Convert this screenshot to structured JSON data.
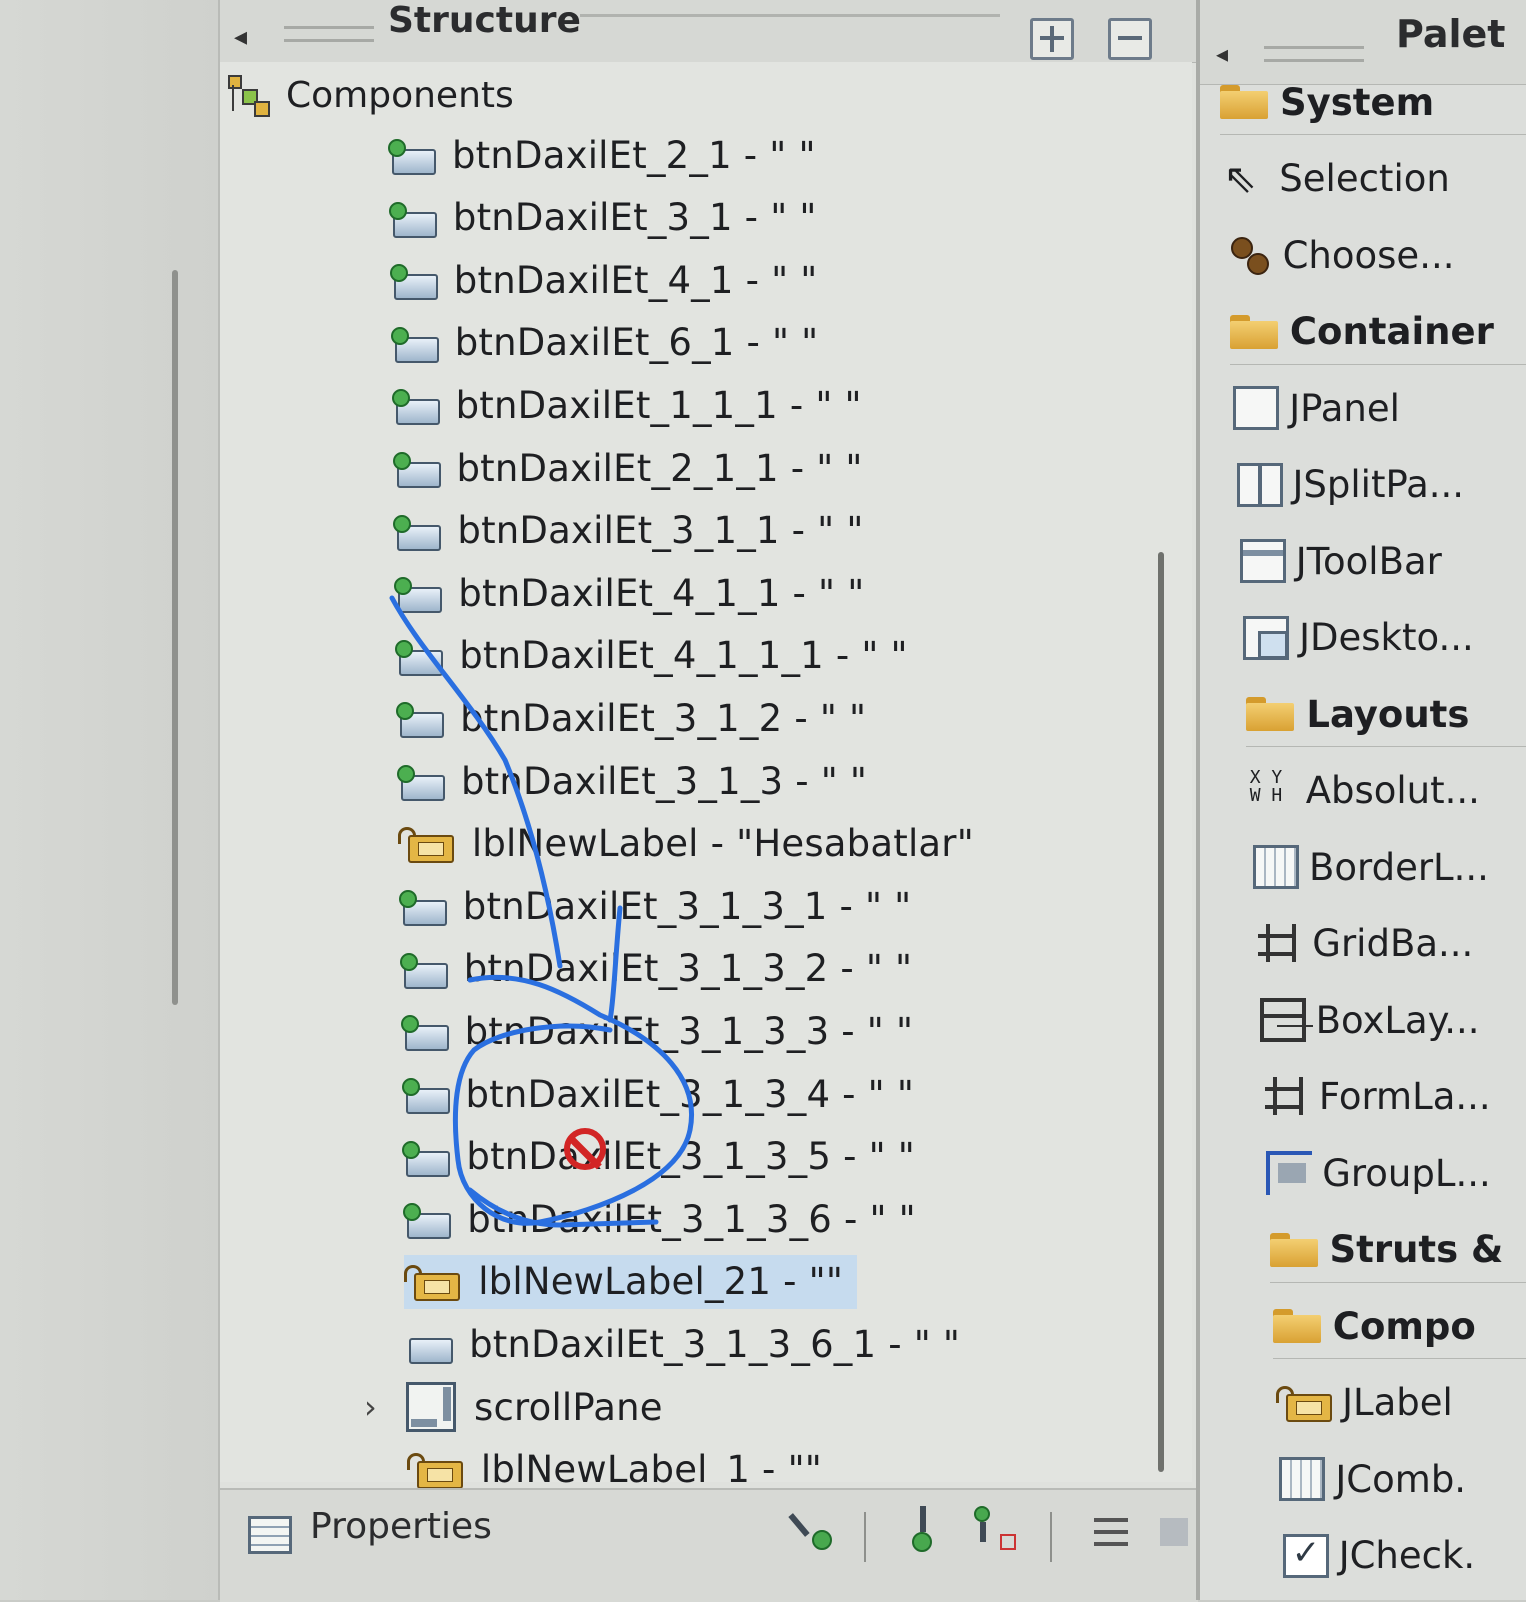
{
  "structure": {
    "title": "Structure",
    "root_label": "Components",
    "items": [
      {
        "label": "btnDaxilEt_2_1 - \" \"",
        "type": "button"
      },
      {
        "label": "btnDaxilEt_3_1 - \" \"",
        "type": "button"
      },
      {
        "label": "btnDaxilEt_4_1 - \" \"",
        "type": "button"
      },
      {
        "label": "btnDaxilEt_6_1 - \" \"",
        "type": "button"
      },
      {
        "label": "btnDaxilEt_1_1_1 - \" \"",
        "type": "button"
      },
      {
        "label": "btnDaxilEt_2_1_1 - \" \"",
        "type": "button"
      },
      {
        "label": "btnDaxilEt_3_1_1 - \" \"",
        "type": "button"
      },
      {
        "label": "btnDaxilEt_4_1_1 - \" \"",
        "type": "button"
      },
      {
        "label": "btnDaxilEt_4_1_1_1 - \" \"",
        "type": "button"
      },
      {
        "label": "btnDaxilEt_3_1_2 - \" \"",
        "type": "button"
      },
      {
        "label": "btnDaxilEt_3_1_3 - \" \"",
        "type": "button"
      },
      {
        "label": "lblNewLabel - \"Hesabatlar\"",
        "type": "label"
      },
      {
        "label": "btnDaxilEt_3_1_3_1 - \" \"",
        "type": "button"
      },
      {
        "label": "btnDaxilEt_3_1_3_2 - \" \"",
        "type": "button"
      },
      {
        "label": "btnDaxilEt_3_1_3_3 - \" \"",
        "type": "button"
      },
      {
        "label": "btnDaxilEt_3_1_3_4 - \" \"",
        "type": "button"
      },
      {
        "label": "btnDaxilEt_3_1_3_5 - \" \"",
        "type": "button"
      },
      {
        "label": "btnDaxilEt_3_1_3_6 - \" \"",
        "type": "button"
      },
      {
        "label": "lblNewLabel_21 - \"\"",
        "type": "label",
        "selected": true
      },
      {
        "label": "btnDaxilEt_3_1_3_6_1 - \" \"",
        "type": "button-plain"
      },
      {
        "label": "scrollPane",
        "type": "scroll"
      },
      {
        "label": "lblNewLabel_1 - \"\"",
        "type": "label"
      }
    ]
  },
  "properties": {
    "title": "Properties"
  },
  "palette": {
    "title": "Palet",
    "rows": [
      {
        "label": "System",
        "kind": "category",
        "icon": "folder-icon"
      },
      {
        "label": "Selection",
        "kind": "tool",
        "icon": "cursor-icon"
      },
      {
        "label": "Choose...",
        "kind": "tool",
        "icon": "beans-icon"
      },
      {
        "label": "Container",
        "kind": "category",
        "icon": "folder-icon"
      },
      {
        "label": "JPanel",
        "kind": "tool",
        "icon": "panel-icon"
      },
      {
        "label": "JSplitPa...",
        "kind": "tool",
        "icon": "split-pane-icon"
      },
      {
        "label": "JToolBar",
        "kind": "tool",
        "icon": "toolbar-icon"
      },
      {
        "label": "JDeskto...",
        "kind": "tool",
        "icon": "desktop-pane-icon"
      },
      {
        "label": "Layouts",
        "kind": "category",
        "icon": "folder-icon"
      },
      {
        "label": "Absolut...",
        "kind": "tool",
        "icon": "xywh-icon"
      },
      {
        "label": "BorderL...",
        "kind": "tool",
        "icon": "border-layout-icon"
      },
      {
        "label": "GridBa...",
        "kind": "tool",
        "icon": "gridbag-icon"
      },
      {
        "label": "BoxLay...",
        "kind": "tool",
        "icon": "box-layout-icon"
      },
      {
        "label": "FormLa...",
        "kind": "tool",
        "icon": "form-layout-icon"
      },
      {
        "label": "GroupL...",
        "kind": "tool",
        "icon": "group-layout-icon"
      },
      {
        "label": "Struts &",
        "kind": "category",
        "icon": "folder-icon"
      },
      {
        "label": "Compo",
        "kind": "category",
        "icon": "folder-icon"
      },
      {
        "label": "JLabel",
        "kind": "tool",
        "icon": "label-icon"
      },
      {
        "label": "JComb.",
        "kind": "tool",
        "icon": "combo-icon"
      },
      {
        "label": "JCheck.",
        "kind": "tool",
        "icon": "checkbox-icon"
      }
    ]
  },
  "colors": {
    "selection": "#c6dbee",
    "annotation_stroke": "#2a6fe0",
    "no_entry": "#d22525"
  }
}
